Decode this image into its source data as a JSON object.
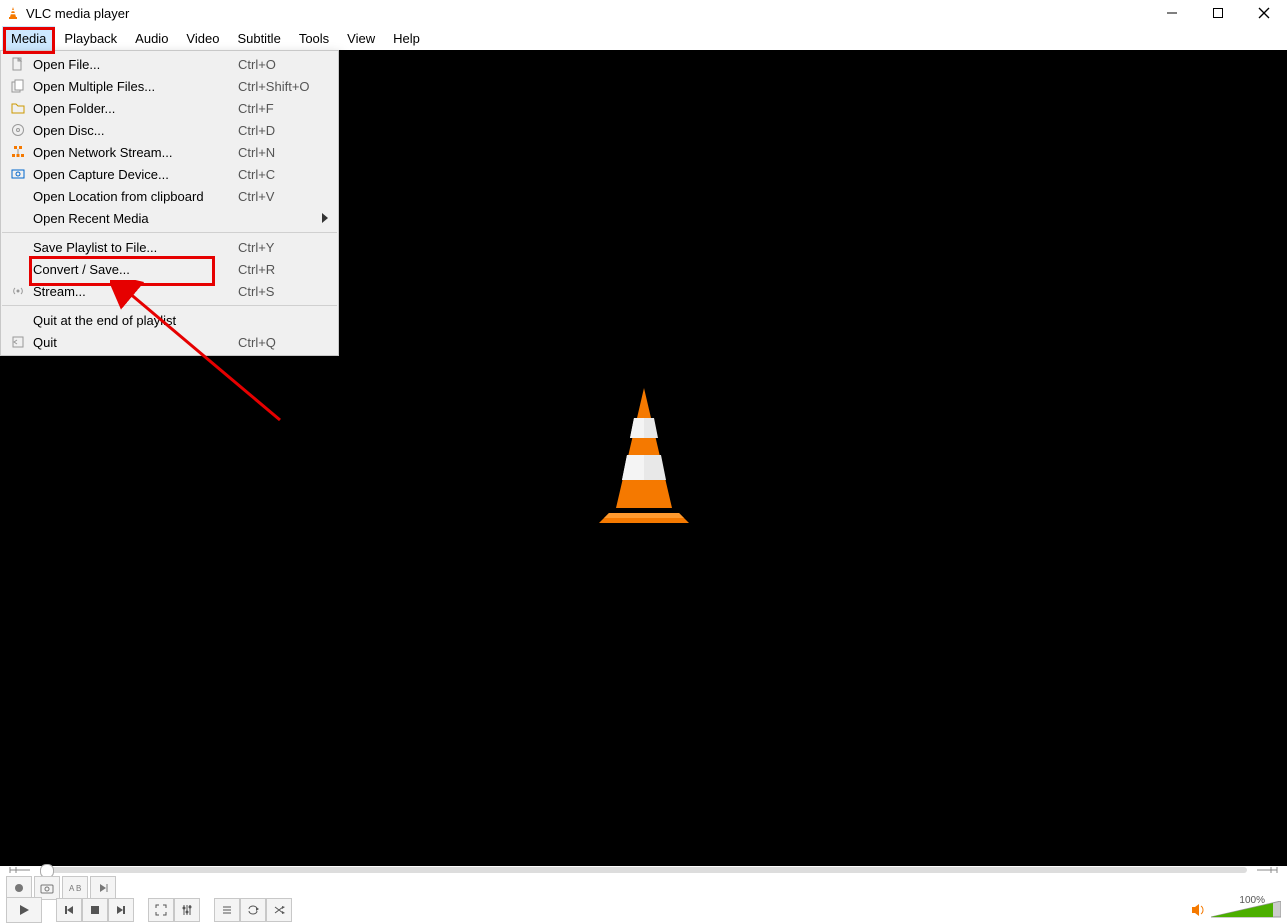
{
  "window": {
    "title": "VLC media player"
  },
  "menubar": [
    "Media",
    "Playback",
    "Audio",
    "Video",
    "Subtitle",
    "Tools",
    "View",
    "Help"
  ],
  "menu_active_index": 0,
  "dropdown": {
    "groups": [
      [
        {
          "icon": "file",
          "label": "Open File...",
          "shortcut": "Ctrl+O"
        },
        {
          "icon": "files",
          "label": "Open Multiple Files...",
          "shortcut": "Ctrl+Shift+O"
        },
        {
          "icon": "folder",
          "label": "Open Folder...",
          "shortcut": "Ctrl+F"
        },
        {
          "icon": "disc",
          "label": "Open Disc...",
          "shortcut": "Ctrl+D"
        },
        {
          "icon": "network",
          "label": "Open Network Stream...",
          "shortcut": "Ctrl+N"
        },
        {
          "icon": "capture",
          "label": "Open Capture Device...",
          "shortcut": "Ctrl+C"
        },
        {
          "icon": "",
          "label": "Open Location from clipboard",
          "shortcut": "Ctrl+V"
        },
        {
          "icon": "",
          "label": "Open Recent Media",
          "shortcut": "",
          "submenu": true
        }
      ],
      [
        {
          "icon": "",
          "label": "Save Playlist to File...",
          "shortcut": "Ctrl+Y"
        },
        {
          "icon": "",
          "label": "Convert / Save...",
          "shortcut": "Ctrl+R",
          "highlight": true
        },
        {
          "icon": "stream",
          "label": "Stream...",
          "shortcut": "Ctrl+S"
        }
      ],
      [
        {
          "icon": "",
          "label": "Quit at the end of playlist",
          "shortcut": ""
        },
        {
          "icon": "quit",
          "label": "Quit",
          "shortcut": "Ctrl+Q"
        }
      ]
    ]
  },
  "volume": {
    "percent_label": "100%",
    "value": 100
  },
  "annotations": {
    "menu_highlight": true,
    "convert_highlight": true,
    "arrow": true
  }
}
